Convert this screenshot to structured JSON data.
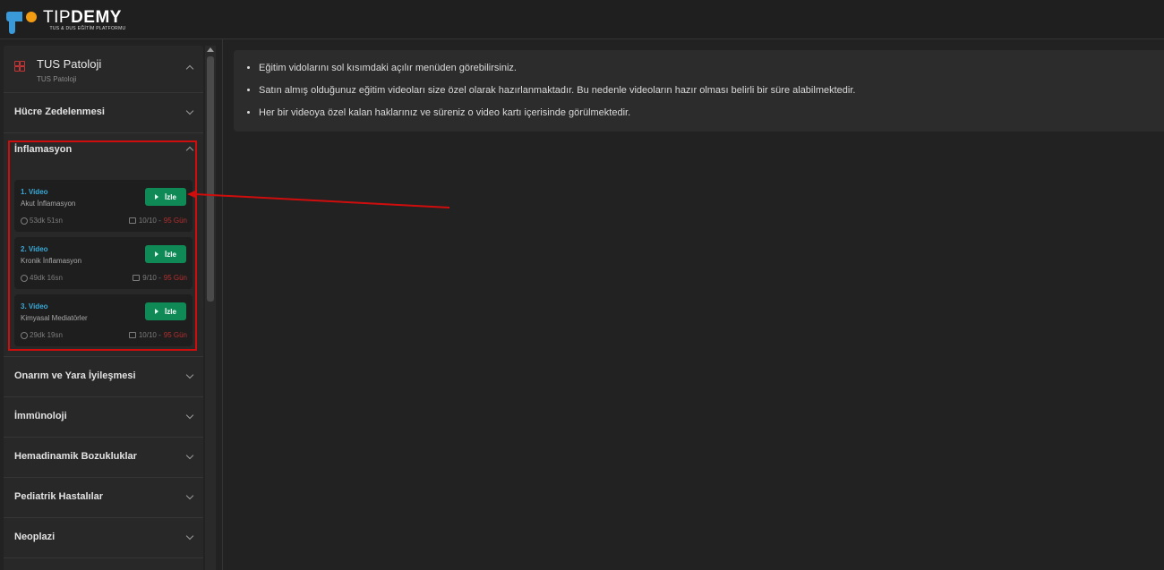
{
  "brand": {
    "name_bold": "TIP",
    "name_rest": "DEMY",
    "tagline": "TUS & DUS EĞİTİM PLATFORMU",
    "colors": {
      "blue": "#3a9ad9",
      "orange": "#f39c12"
    }
  },
  "course": {
    "title": "TUS Patoloji",
    "subtitle": "TUS Patoloji",
    "icon": "grid-icon"
  },
  "sections_before": [
    {
      "label": "Hücre Zedelenmesi"
    }
  ],
  "open_section": {
    "label": "İnflamasyon",
    "videos": [
      {
        "num": "1. Video",
        "name": "Akut İnflamasyon",
        "button": "İzle",
        "duration": "53dk 51sn",
        "rights": "10/10 -",
        "remaining": "95 Gün"
      },
      {
        "num": "2. Video",
        "name": "Kronik İnflamasyon",
        "button": "İzle",
        "duration": "49dk 16sn",
        "rights": "9/10 -",
        "remaining": "95 Gün"
      },
      {
        "num": "3. Video",
        "name": "Kimyasal Mediatörler",
        "button": "İzle",
        "duration": "29dk 19sn",
        "rights": "10/10 -",
        "remaining": "95 Gün"
      }
    ]
  },
  "sections_after": [
    {
      "label": "Onarım ve Yara İyileşmesi"
    },
    {
      "label": "İmmünoloji"
    },
    {
      "label": "Hemadinamik Bozukluklar"
    },
    {
      "label": "Pediatrik Hastalılar"
    },
    {
      "label": "Neoplazi"
    }
  ],
  "info": [
    "Eğitim vidolarını sol kısımdaki açılır menüden görebilirsiniz.",
    "Satın almış olduğunuz eğitim videoları size özel olarak hazırlanmaktadır. Bu nedenle videoların hazır olması belirli bir süre alabilmektedir.",
    "Her bir videoya özel kalan haklarınız ve süreniz o video kartı içerisinde görülmektedir."
  ],
  "annotation": {
    "color": "#d00d0d"
  }
}
